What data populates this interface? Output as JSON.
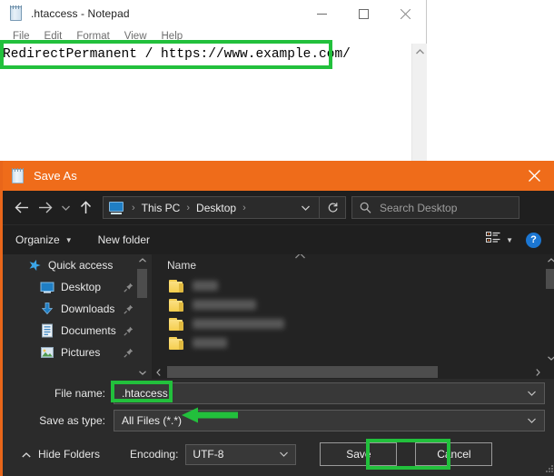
{
  "notepad": {
    "title": ".htaccess - Notepad",
    "icon": "notepad-icon",
    "menus": [
      "File",
      "Edit",
      "Format",
      "View",
      "Help"
    ],
    "text_content": "RedirectPermanent / https://www.example.com/",
    "window_buttons": {
      "minimize": "minimize-icon",
      "maximize": "maximize-icon",
      "close": "close-icon"
    }
  },
  "save_dialog": {
    "title": "Save As",
    "icon": "notepad-icon",
    "close_label": "close-icon",
    "titlebar_color": "#ef6c1a",
    "nav": {
      "back": "arrow-left-icon",
      "forward": "arrow-right-icon",
      "recent": "chevron-down-icon",
      "up": "arrow-up-icon",
      "breadcrumb": [
        "This PC",
        "Desktop"
      ],
      "breadcrumb_icon": "this-pc-icon",
      "address_dropdown": "chevron-down-icon",
      "refresh": "refresh-icon"
    },
    "search": {
      "icon": "search-icon",
      "placeholder": "Search Desktop",
      "value": ""
    },
    "commandbar": {
      "organize": "Organize",
      "new_folder": "New folder",
      "view_icon": "view-mode-icon",
      "help": "?"
    },
    "navpane": {
      "items": [
        {
          "label": "Quick access",
          "icon": "star-icon",
          "level": 0,
          "pinned": false
        },
        {
          "label": "Desktop",
          "icon": "desktop-icon",
          "level": 1,
          "pinned": true
        },
        {
          "label": "Downloads",
          "icon": "download-icon",
          "level": 1,
          "pinned": true
        },
        {
          "label": "Documents",
          "icon": "documents-icon",
          "level": 1,
          "pinned": true
        },
        {
          "label": "Pictures",
          "icon": "pictures-icon",
          "level": 1,
          "pinned": true
        }
      ]
    },
    "filelist": {
      "column_header": "Name",
      "rows": [
        {
          "icon": "folder-icon",
          "name": "",
          "redacted": true,
          "blur_width": 28
        },
        {
          "icon": "folder-icon",
          "name": "",
          "redacted": true,
          "blur_width": 70
        },
        {
          "icon": "folder-icon",
          "name": "",
          "redacted": true,
          "blur_width": 101
        },
        {
          "icon": "folder-icon",
          "name": "",
          "redacted": true,
          "blur_width": 38
        }
      ]
    },
    "form": {
      "file_name_label": "File name:",
      "file_name_value": ".htaccess",
      "save_as_type_label": "Save as type:",
      "save_as_type_value": "All Files  (*.*)"
    },
    "footer": {
      "hide_folders": "Hide Folders",
      "hide_folders_icon": "chevron-up-icon",
      "encoding_label": "Encoding:",
      "encoding_value": "UTF-8",
      "save_label": "Save",
      "cancel_label": "Cancel"
    }
  },
  "annotations": {
    "highlight_color": "#22c03c",
    "boxes": [
      {
        "name": "notepad-text-highlight",
        "target": "notepad text line"
      },
      {
        "name": "file-name-highlight",
        "target": "File name value"
      },
      {
        "name": "save-button-highlight",
        "target": "Save button"
      }
    ],
    "arrow": {
      "name": "save-as-type-arrow",
      "direction": "left",
      "target": "Save as type value"
    }
  }
}
